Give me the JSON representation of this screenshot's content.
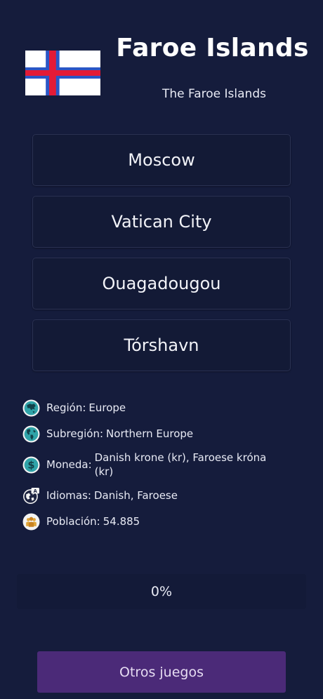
{
  "country": {
    "name": "Faroe Islands",
    "official_name": "The Faroe Islands",
    "flag_icon": "faroe-islands-flag",
    "flag_colors": {
      "field": "#ffffff",
      "outer_cross": "#2a56c6",
      "inner_cross": "#e31b37"
    }
  },
  "options": [
    {
      "label": "Moscow"
    },
    {
      "label": "Vatican City"
    },
    {
      "label": "Ouagadougou"
    },
    {
      "label": "Tórshavn"
    }
  ],
  "info": {
    "region": {
      "label": "Región:",
      "value": "Europe",
      "icon": "globe-asia-icon"
    },
    "subregion": {
      "label": "Subregión:",
      "value": "Northern Europe",
      "icon": "globe-americas-icon"
    },
    "currency": {
      "label": "Moneda:",
      "value": "Danish krone (kr), Faroese króna (kr)",
      "icon": "dollar-coin-icon"
    },
    "languages": {
      "label": "Idiomas:",
      "value": "Danish, Faroese",
      "icon": "language-globe-icon"
    },
    "population": {
      "label": "Población:",
      "value": "54.885",
      "icon": "people-icon"
    }
  },
  "progress": {
    "text": "0%",
    "value": 0
  },
  "footer": {
    "other_games_label": "Otros juegos"
  },
  "colors": {
    "background": "#151c3c",
    "accent": "#4b2a78",
    "icon_teal": "#2fa3a8"
  }
}
